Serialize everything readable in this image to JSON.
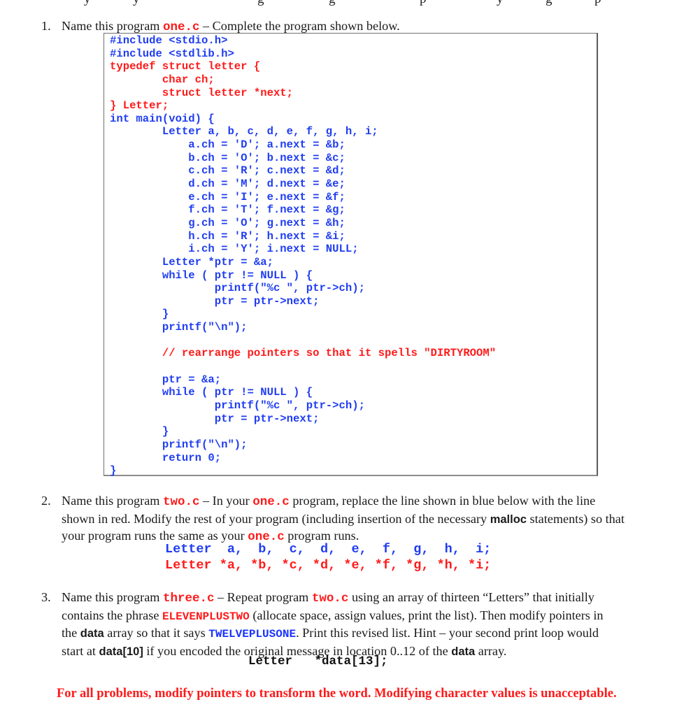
{
  "problems": [
    {
      "number": "1.",
      "intro_prefix": "Name this program ",
      "program_name": "one.c",
      "intro_suffix": " – Complete the program shown below.",
      "code_lines": [
        {
          "text": "#include <stdio.h>",
          "color": "blue"
        },
        {
          "text": "#include <stdlib.h>",
          "color": "blue"
        },
        {
          "text": "typedef struct letter {",
          "color": "red"
        },
        {
          "text": "        char ch;",
          "color": "red"
        },
        {
          "text": "        struct letter *next;",
          "color": "red"
        },
        {
          "text": "} Letter;",
          "color": "red"
        },
        {
          "text": "int main(void) {",
          "color": "blue"
        },
        {
          "text": "        Letter a, b, c, d, e, f, g, h, i;",
          "color": "blue"
        },
        {
          "text": "            a.ch = 'D'; a.next = &b;",
          "color": "blue"
        },
        {
          "text": "            b.ch = 'O'; b.next = &c;",
          "color": "blue"
        },
        {
          "text": "            c.ch = 'R'; c.next = &d;",
          "color": "blue"
        },
        {
          "text": "            d.ch = 'M'; d.next = &e;",
          "color": "blue"
        },
        {
          "text": "            e.ch = 'I'; e.next = &f;",
          "color": "blue"
        },
        {
          "text": "            f.ch = 'T'; f.next = &g;",
          "color": "blue"
        },
        {
          "text": "            g.ch = 'O'; g.next = &h;",
          "color": "blue"
        },
        {
          "text": "            h.ch = 'R'; h.next = &i;",
          "color": "blue"
        },
        {
          "text": "            i.ch = 'Y'; i.next = NULL;",
          "color": "blue"
        },
        {
          "text": "        Letter *ptr = &a;",
          "color": "blue"
        },
        {
          "text": "        while ( ptr != NULL ) {",
          "color": "blue"
        },
        {
          "text": "                printf(\"%c \", ptr->ch);",
          "color": "blue"
        },
        {
          "text": "                ptr = ptr->next;",
          "color": "blue"
        },
        {
          "text": "        }",
          "color": "blue"
        },
        {
          "text": "        printf(\"\\n\");",
          "color": "blue"
        },
        {
          "text": "",
          "color": "blue"
        },
        {
          "text": "        // rearrange pointers so that it spells \"DIRTYROOM\"",
          "color": "red"
        },
        {
          "text": "",
          "color": "blue"
        },
        {
          "text": "        ptr = &a;",
          "color": "blue"
        },
        {
          "text": "        while ( ptr != NULL ) {",
          "color": "blue"
        },
        {
          "text": "                printf(\"%c \", ptr->ch);",
          "color": "blue"
        },
        {
          "text": "                ptr = ptr->next;",
          "color": "blue"
        },
        {
          "text": "        }",
          "color": "blue"
        },
        {
          "text": "        printf(\"\\n\");",
          "color": "blue"
        },
        {
          "text": "        return 0;",
          "color": "blue"
        },
        {
          "text": "}",
          "color": "blue"
        }
      ]
    },
    {
      "number": "2.",
      "t1": "Name this program ",
      "program_name": "two.c",
      "t2": " – In your ",
      "ref_program": "one.c",
      "t3": " program, replace the line shown in blue below with the line",
      "t4": "shown in red.  Modify the rest of your program (including insertion of the necessary ",
      "keyword": "malloc",
      "t5": " statements) so that",
      "t6": "your program runs the same as your ",
      "ref_program2": "one.c",
      "t7": " program runs.",
      "old_line": "Letter  a,  b,  c,  d,  e,  f,  g,  h,  i;",
      "new_line": "Letter *a, *b, *c, *d, *e, *f, *g, *h, *i;"
    },
    {
      "number": "3.",
      "t1": "Name this program ",
      "program_name": "three.c",
      "t2": " – Repeat program ",
      "ref_program": "two.c",
      "t3": " using an array of thirteen “Letters” that initially",
      "t4": "contains the phrase ",
      "phrase_original": "ELEVENPLUSTWO",
      "t5": " (allocate space, assign values, print the list).  Then modify pointers in",
      "t6": "the ",
      "array_name": "data",
      "t7": " array so that it says ",
      "phrase_target": "TWELVEPLUSONE",
      "t8": ".  Print this revised list.  Hint – your second print loop would",
      "t9": "start at ",
      "start_index": "data[10]",
      "t10": " if you encoded the original message in location 0..12 of the ",
      "array_name2": "data",
      "t11": " array.",
      "declaration": "Letter   *data[13];"
    }
  ],
  "footer_note": "For all problems, modify pointers to transform the word.  Modifying character values is unacceptable.",
  "colors": {
    "red": "#ff1a1a",
    "blue": "#1f3df2",
    "border": "#707070"
  }
}
